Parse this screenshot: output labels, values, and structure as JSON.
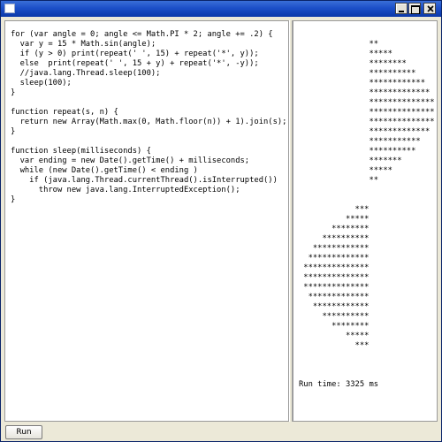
{
  "window": {
    "title": ""
  },
  "editor": {
    "lines": [
      "for (var angle = 0; angle <= Math.PI * 2; angle += .2) {",
      "  var y = 15 * Math.sin(angle);",
      "  if (y > 0) print(repeat(' ', 15) + repeat('*', y));",
      "  else  print(repeat(' ', 15 + y) + repeat('*', -y));",
      "  //java.lang.Thread.sleep(100);",
      "  sleep(100);",
      "}",
      "",
      "function repeat(s, n) {",
      "  return new Array(Math.max(0, Math.floor(n)) + 1).join(s);",
      "}",
      "",
      "function sleep(milliseconds) {",
      "  var ending = new Date().getTime() + milliseconds;",
      "  while (new Date().getTime() < ending )",
      "    if (java.lang.Thread.currentThread().isInterrupted())",
      "      throw new java.lang.InterruptedException();",
      "}"
    ]
  },
  "output": {
    "lines": [
      "",
      "               **",
      "               *****",
      "               ********",
      "               **********",
      "               ************",
      "               *************",
      "               **************",
      "               **************",
      "               **************",
      "               *************",
      "               ***********",
      "               **********",
      "               *******",
      "               *****",
      "               **",
      "",
      "",
      "            ***",
      "          *****",
      "       ********",
      "     **********",
      "   ************",
      "  *************",
      " **************",
      " **************",
      " **************",
      "  *************",
      "   ************",
      "     **********",
      "       ********",
      "          *****",
      "            ***",
      "",
      "",
      "",
      "Run time: 3325 ms"
    ]
  },
  "controls": {
    "run_label": "Run"
  },
  "colors": {
    "titlebar": "#1c4fc8",
    "chrome": "#ece9d8"
  }
}
